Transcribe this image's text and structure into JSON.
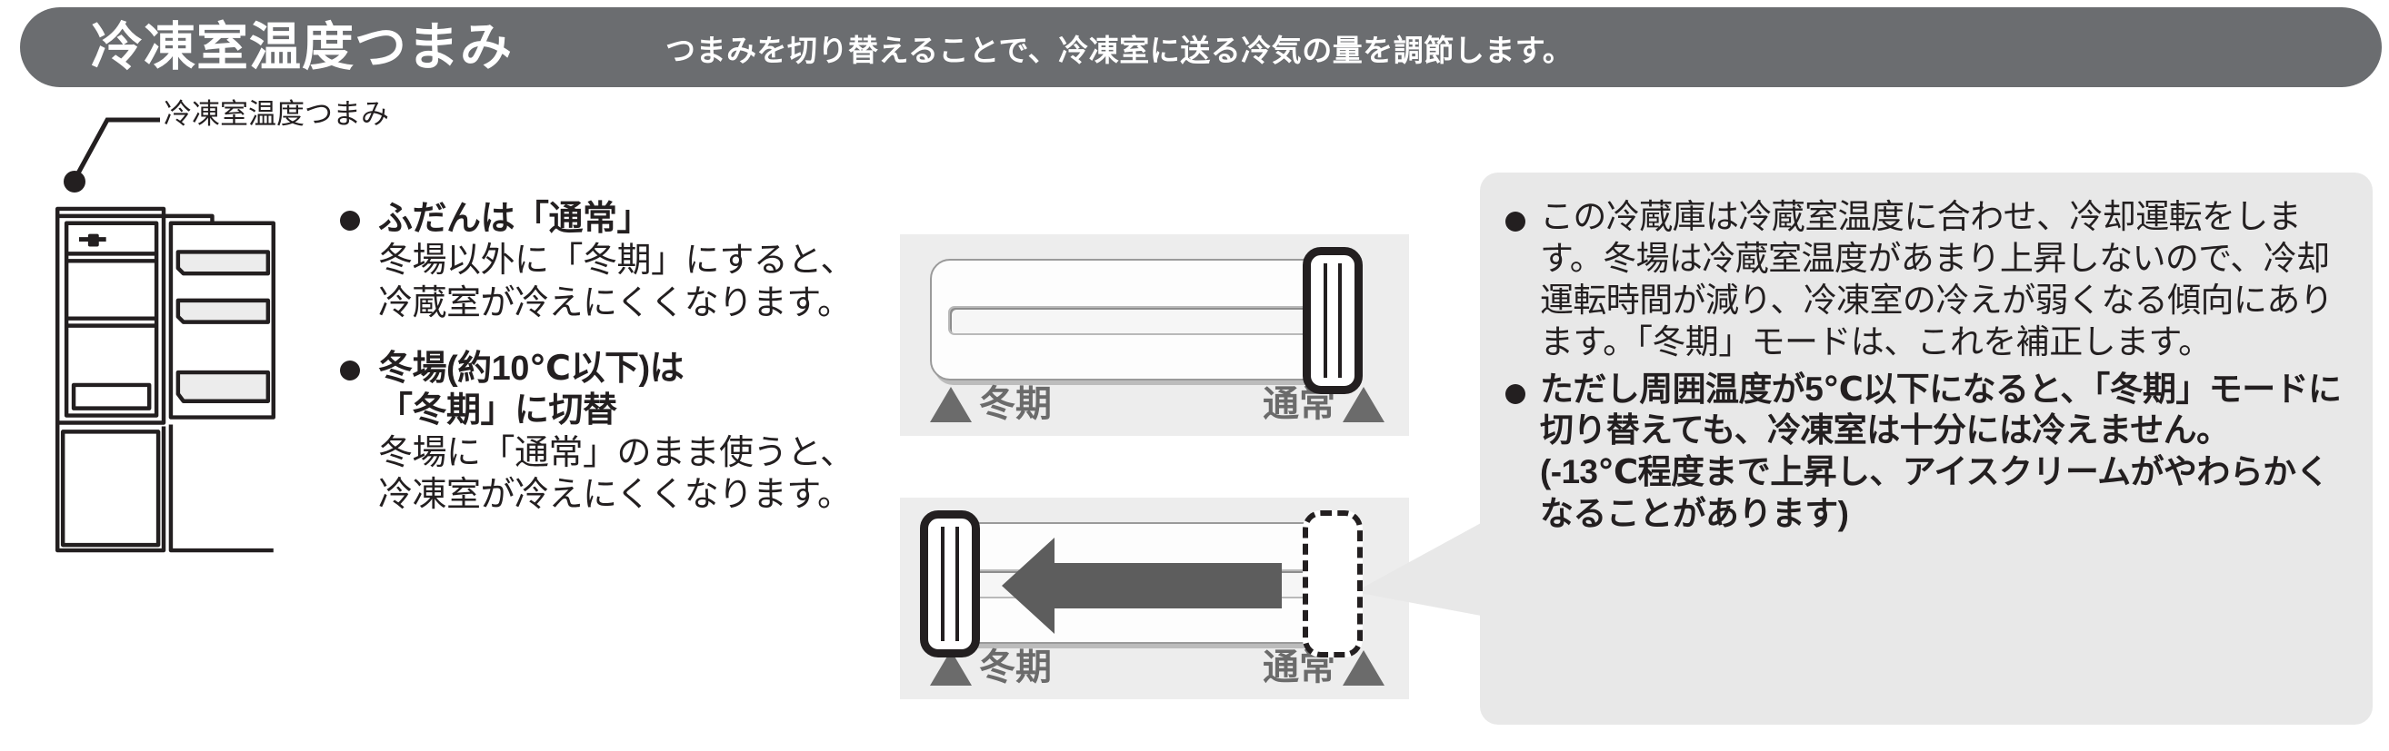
{
  "header": {
    "title": "冷凍室温度つまみ",
    "subtitle": "つまみを切り替えることで、冷凍室に送る冷気の量を調節します。",
    "bg_color": "#6b6d70",
    "text_color": "#ffffff"
  },
  "illustration": {
    "callout_label": "冷凍室温度つまみ"
  },
  "left_column": {
    "bullets": [
      {
        "heading": "ふだんは「通常」",
        "body": "冬場以外に「冬期」にすると、冷蔵室が冷えにくくなります。"
      },
      {
        "heading": "冬場(約10℃以下)は\n「冬期」に切替",
        "body": "冬場に「通常」のまま使うと、冷凍室が冷えにくくなります。"
      }
    ]
  },
  "sliders": [
    {
      "name": "normal-position",
      "left_label": "冬期",
      "right_label": "通常",
      "knob_position": "right",
      "ghost_knob": false,
      "arrow": false,
      "label_color": "#6b6b6b",
      "panel_color": "#ededed"
    },
    {
      "name": "winter-position",
      "left_label": "冬期",
      "right_label": "通常",
      "knob_position": "left",
      "ghost_knob": true,
      "arrow": true,
      "arrow_direction": "left",
      "label_color": "#6b6b6b",
      "panel_color": "#ededed"
    }
  ],
  "callout": {
    "bg_color": "#e8e8e8",
    "items": [
      {
        "style": "normal",
        "text": "この冷蔵庫は冷蔵室温度に合わせ、冷却運転をします。冬場は冷蔵室温度があまり上昇しないので、冷却運転時間が減り、冷凍室の冷えが弱くなる傾向にあります。「冬期」モードは、これを補正します。"
      },
      {
        "style": "bold",
        "text": "ただし周囲温度が5℃以下になると、「冬期」モードに切り替えても、冷凍室は十分には冷えません。\n(-13℃程度まで上昇し、アイスクリームがやわらかくなることがあります)"
      }
    ]
  }
}
